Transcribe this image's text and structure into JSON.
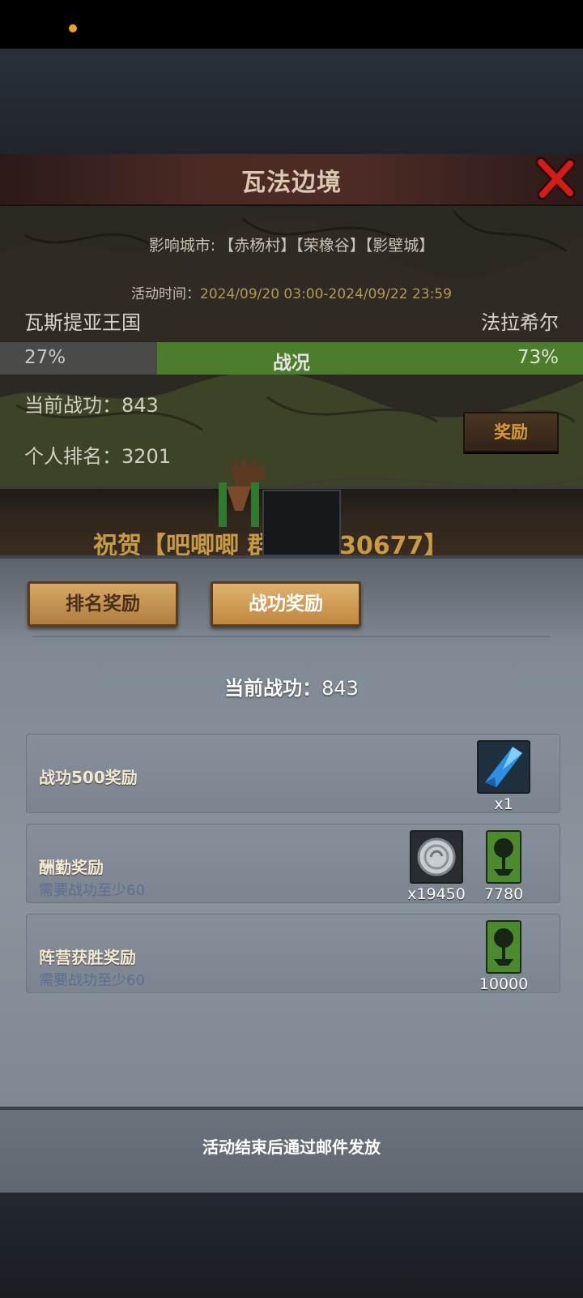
{
  "dialog": {
    "title": "瓦法边境",
    "cities_label": "影响城市:",
    "cities": "【赤杨村】【荣橡谷】【影壁城】",
    "time_label": "活动时间：",
    "time_value": "2024/09/20 03:00-2024/09/22 23:59",
    "faction_left": "瓦斯提亚王国",
    "faction_right": "法拉希尔",
    "war_left_pct": "27%",
    "war_label": "战况",
    "war_right_pct": "73%",
    "war_right_fraction": 0.73,
    "current_merit": "当前战功：843",
    "personal_rank": "个人排名：3201",
    "reward_button": "奖励",
    "news": "祝贺【吧唧唧 群884130677】"
  },
  "reward_panel": {
    "tabs": [
      "排名奖励",
      "战功奖励"
    ],
    "active_tab": "战功奖励",
    "current_merit_label": "当前战功：",
    "current_merit_value": "843",
    "rows": [
      {
        "title": "战功500奖励",
        "subtitle": "",
        "items": [
          {
            "icon": "blue-crystal-icon",
            "count": "x1"
          }
        ]
      },
      {
        "title": "酬勤奖励",
        "subtitle": "需要战功至少60",
        "items": [
          {
            "icon": "silver-coin-icon",
            "count": "x19450"
          },
          {
            "icon": "tree-banner-icon",
            "count": "7780"
          }
        ]
      },
      {
        "title": "阵营获胜奖励",
        "subtitle": "需要战功至少60",
        "items": [
          {
            "icon": "tree-banner-icon",
            "count": "10000"
          }
        ]
      }
    ],
    "footer": "活动结束后通过邮件发放"
  },
  "colors": {
    "war_green": "#4b7d2c",
    "tab_gold": "#d6a865",
    "time_gold": "#b39a54"
  }
}
